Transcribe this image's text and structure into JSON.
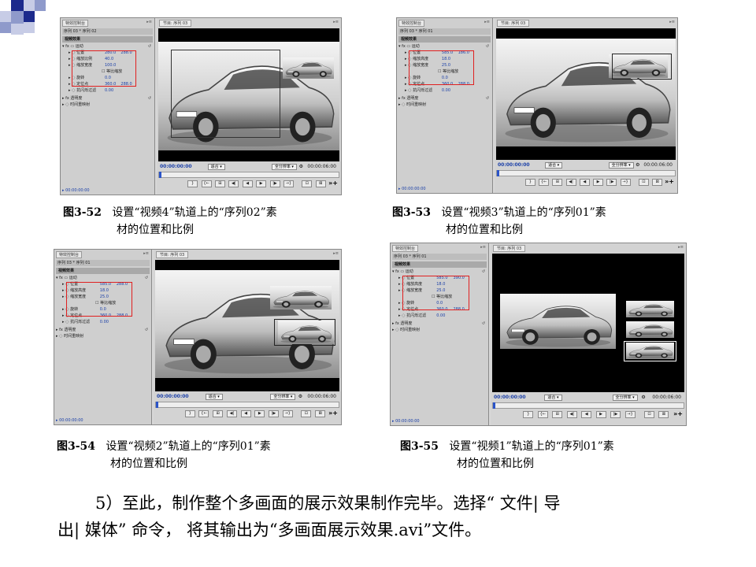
{
  "slide": {
    "decoration_colors": [
      "#1c2a8c",
      "#8f9acb",
      "#c7cce6"
    ]
  },
  "figures": [
    {
      "id": "3-52",
      "caption_num": "图3-52",
      "caption_line1": "设置“视频4”轨道上的“序列02”素",
      "caption_line2": "材的位置和比例",
      "panel_tab": "特效控制台",
      "sequence": "序列 03 * 序列 02",
      "section": "视频效果",
      "motion": "运动",
      "params": [
        {
          "label": "位置",
          "v1": "280.0",
          "v2": "288.0"
        },
        {
          "label": "缩放比例",
          "v1": "40.0",
          "v2": ""
        },
        {
          "label": "缩放宽度",
          "v1": "100.0",
          "v2": ""
        },
        {
          "label": "等比缩放",
          "v1": "",
          "v2": ""
        },
        {
          "label": "旋转",
          "v1": "0.0",
          "v2": ""
        },
        {
          "label": "定位点",
          "v1": "360.0",
          "v2": "288.0"
        },
        {
          "label": "抗闪烁过滤",
          "v1": "0.00",
          "v2": ""
        }
      ],
      "opacity": "透明度",
      "timeremap": "时间重映射",
      "footer_time": "00:00:00:00",
      "monitor_tab": "节目: 序列 03",
      "timecode_left": "00:00:00:00",
      "fit": "适合",
      "full": "全分辨率",
      "timecode_right": "00:00:06:00"
    },
    {
      "id": "3-53",
      "caption_num": "图3-53",
      "caption_line1": "设置“视频3”轨道上的“序列01”素",
      "caption_line2": "材的位置和比例",
      "panel_tab": "特效控制台",
      "sequence": "序列 03 * 序列 01",
      "section": "视频效果",
      "motion": "运动",
      "params": [
        {
          "label": "位置",
          "v1": "585.0",
          "v2": "186.0"
        },
        {
          "label": "缩放高度",
          "v1": "18.0",
          "v2": ""
        },
        {
          "label": "缩放宽度",
          "v1": "25.0",
          "v2": ""
        },
        {
          "label": "等比缩放",
          "v1": "",
          "v2": ""
        },
        {
          "label": "旋转",
          "v1": "0.0",
          "v2": ""
        },
        {
          "label": "定位点",
          "v1": "360.0",
          "v2": "288.0"
        },
        {
          "label": "抗闪烁过滤",
          "v1": "0.00",
          "v2": ""
        }
      ],
      "opacity": "透明度",
      "timeremap": "时间重映射",
      "footer_time": "00:00:00:00",
      "monitor_tab": "节目: 序列 03",
      "timecode_left": "00:00:00:00",
      "fit": "适合",
      "full": "全分辨率",
      "timecode_right": "00:00:06:00"
    },
    {
      "id": "3-54",
      "caption_num": "图3-54",
      "caption_line1": "设置“视频2”轨道上的“序列01”素",
      "caption_line2": "材的位置和比例",
      "panel_tab": "特效控制台",
      "sequence": "序列 03 * 序列 01",
      "section": "视频效果",
      "motion": "运动",
      "params": [
        {
          "label": "位置",
          "v1": "585.0",
          "v2": "288.0"
        },
        {
          "label": "缩放高度",
          "v1": "18.0",
          "v2": ""
        },
        {
          "label": "缩放宽度",
          "v1": "25.0",
          "v2": ""
        },
        {
          "label": "等比缩放",
          "v1": "",
          "v2": ""
        },
        {
          "label": "旋转",
          "v1": "0.0",
          "v2": ""
        },
        {
          "label": "定位点",
          "v1": "360.0",
          "v2": "288.0"
        },
        {
          "label": "抗闪烁过滤",
          "v1": "0.00",
          "v2": ""
        }
      ],
      "opacity": "透明度",
      "timeremap": "时间重映射",
      "footer_time": "00:00:00:00",
      "monitor_tab": "节目: 序列 03",
      "timecode_left": "00:00:00:00",
      "fit": "适合",
      "full": "全分辨率",
      "timecode_right": "00:00:06:00"
    },
    {
      "id": "3-55",
      "caption_num": "图3-55",
      "caption_line1": "设置“视频1”轨道上的“序列01”素",
      "caption_line2": "材的位置和比例",
      "panel_tab": "特效控制台",
      "sequence": "序列 03 * 序列 01",
      "section": "视频效果",
      "motion": "运动",
      "params": [
        {
          "label": "位置",
          "v1": "585.0",
          "v2": "390.0"
        },
        {
          "label": "缩放高度",
          "v1": "18.0",
          "v2": ""
        },
        {
          "label": "缩放宽度",
          "v1": "25.0",
          "v2": ""
        },
        {
          "label": "等比缩放",
          "v1": "",
          "v2": ""
        },
        {
          "label": "旋转",
          "v1": "0.0",
          "v2": ""
        },
        {
          "label": "定位点",
          "v1": "360.0",
          "v2": "288.0"
        },
        {
          "label": "抗闪烁过滤",
          "v1": "0.00",
          "v2": ""
        }
      ],
      "opacity": "透明度",
      "timeremap": "时间重映射",
      "footer_time": "00:00:00:00",
      "monitor_tab": "节目: 序列 03",
      "timecode_left": "00:00:00:00",
      "fit": "适合",
      "full": "全分辨率",
      "timecode_right": "00:00:06:00"
    }
  ],
  "controls": [
    "}",
    "{←",
    "⊞",
    "◀|",
    "◀",
    "▶",
    "|▶",
    "→}",
    "⊡",
    "⊠"
  ],
  "body": {
    "line1": "5）至此，制作整个多画面的展示效果制作完毕。选择“ 文件| 导",
    "line2": "出| 媒体” 命令， 将其输出为“多画面展示效果.avi”文件。"
  }
}
